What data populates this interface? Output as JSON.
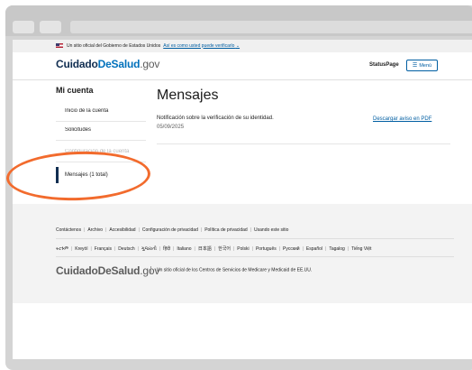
{
  "gov_banner": {
    "text": "Un sitio oficial del Gobierno de Estados Unidos",
    "link": "Así es como usted puede verificarlo"
  },
  "header": {
    "logo_part1": "Cuidado",
    "logo_part2": "DeSalud",
    "logo_suffix": ".gov",
    "status_page": "StatusPage",
    "menu_label": "Menú",
    "menu_icon": "hamburger-menu-icon"
  },
  "sidebar": {
    "title": "Mi cuenta",
    "items": [
      {
        "label": "Inicio de la cuenta"
      },
      {
        "label": "Solicitudes"
      },
      {
        "label": "Configuración de la cuenta"
      },
      {
        "label": "Mensajes (1 total)"
      }
    ]
  },
  "main": {
    "title": "Mensajes",
    "notice_title": "Notificación sobre la verificación de su identidad.",
    "notice_date": "05/09/2025",
    "download_link": "Descargar aviso en PDF"
  },
  "footer": {
    "links": [
      "Contáctenos",
      "Archivo",
      "Accesibilidad",
      "Configuración de privacidad",
      "Política de privacidad",
      "Usando este sitio"
    ],
    "languages": [
      "ትርጉም",
      "Kreyòl",
      "Français",
      "Deutsch",
      "ગુજરાતી",
      "हिंदी",
      "Italiano",
      "日本語",
      "한국어",
      "Polski",
      "Português",
      "Русский",
      "Español",
      "Tagalog",
      "Tiếng Việt"
    ],
    "logo_part1": "Cuidado",
    "logo_part2": "DeSalud",
    "logo_suffix": ".gov",
    "official_text": "Un sitio oficial de los Centros de Servicios de Medicare y Medicaid de EE.UU."
  },
  "colors": {
    "brand_navy": "#112e51",
    "brand_blue": "#0071bc",
    "link": "#005ea2",
    "annotation": "#f26b2d"
  }
}
